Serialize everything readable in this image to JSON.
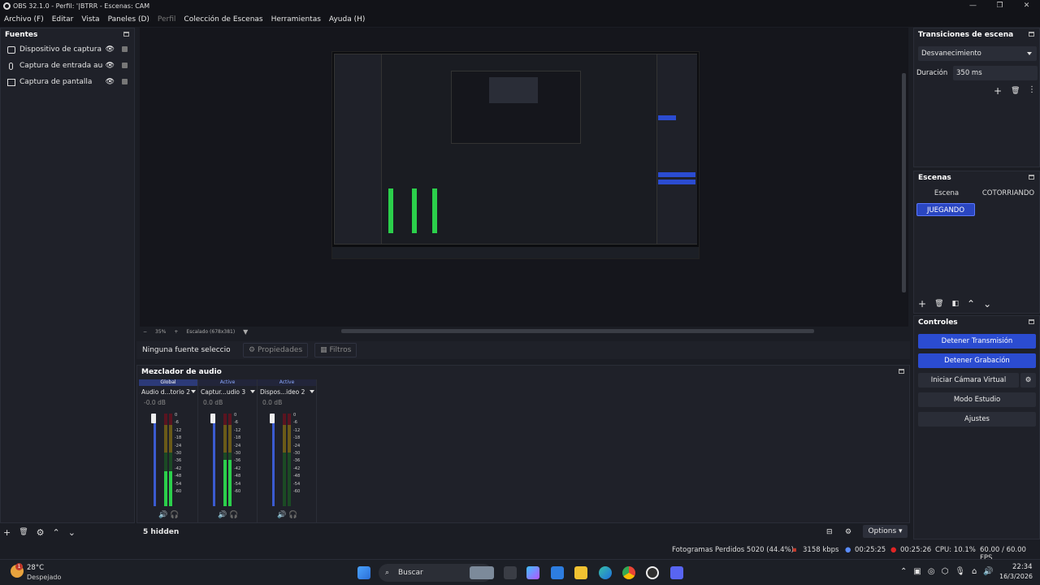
{
  "window": {
    "title": "OBS 32.1.0 - Perfil: '|BTRR - Escenas: CAM",
    "controls": [
      "—",
      "❐",
      "✕"
    ]
  },
  "menu": [
    "Archivo (F)",
    "Editar",
    "Vista",
    "Paneles (D)",
    "Perfil",
    "Colección de Escenas",
    "Herramientas",
    "Ayuda (H)"
  ],
  "sources": {
    "title": "Fuentes",
    "items": [
      {
        "label": "Dispositivo de captura de video",
        "icon": "camera-icon"
      },
      {
        "label": "Captura de entrada audio",
        "icon": "microphone-icon"
      },
      {
        "label": "Captura de pantalla",
        "icon": "monitor-icon"
      }
    ],
    "toolbar": [
      "+",
      "🗑",
      "⚙",
      "⌃",
      "⌄"
    ]
  },
  "preview": {
    "scale_minus": "−",
    "scale_value": "35%",
    "scale_plus": "+",
    "scale_label": "Escalado (678x381)"
  },
  "properties_bar": {
    "no_selection": "Ninguna fuente seleccionada",
    "properties": "Propiedades",
    "filters": "Filtros"
  },
  "mixer": {
    "title": "Mezclador de audio",
    "channels": [
      {
        "badge": "Global",
        "name": "Audio d...torio 2",
        "db": "-0.0 dB",
        "level": 0.38
      },
      {
        "badge": "Active",
        "name": "Captur...udio 3",
        "db": "0.0 dB",
        "level": 0.5
      },
      {
        "badge": "Active",
        "name": "Dispos...ideo 2",
        "db": "0.0 dB",
        "level": 0.0
      }
    ],
    "ticks": [
      "0",
      "-6",
      "-12",
      "-18",
      "-24",
      "-30",
      "-36",
      "-42",
      "-48",
      "-54",
      "-60"
    ],
    "hidden": "5 hidden",
    "options": "Options"
  },
  "transitions": {
    "title": "Transiciones de escena",
    "selected": "Desvanecimiento",
    "duration_label": "Duración",
    "duration_value": "350 ms"
  },
  "scenes": {
    "title": "Escenas",
    "items": [
      "Escena",
      "COTORRIANDO",
      "JUEGANDO"
    ],
    "selected": "JUEGANDO"
  },
  "controls": {
    "title": "Controles",
    "buttons": [
      "Detener Transmisión",
      "Detener Grabación",
      "Iniciar Cámara Virtual",
      "Modo Estudio",
      "Ajustes"
    ]
  },
  "status": {
    "dropped": "Fotogramas Perdidos 5020 (44.4%)",
    "bitrate": "3158 kbps",
    "stream_time": "00:25:25",
    "rec_time": "00:25:26",
    "cpu": "CPU: 10.1%",
    "fps": "60.00 / 60.00 FPS"
  },
  "taskbar": {
    "weather_temp": "28°C",
    "weather_desc": "Despejado",
    "search": "Buscar",
    "time": "22:34",
    "date": "16/3/2026",
    "badge": "1"
  }
}
